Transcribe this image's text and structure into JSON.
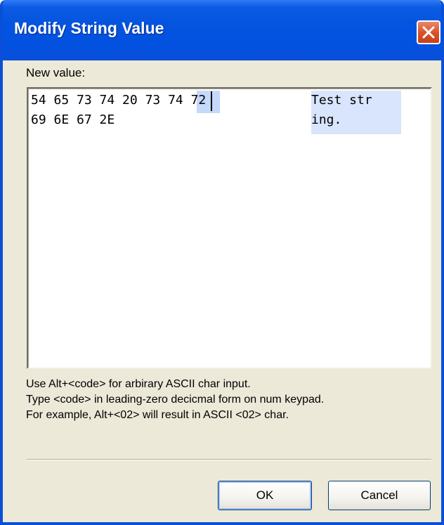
{
  "window": {
    "title": "Modify String Value",
    "close_icon": "close-icon"
  },
  "editor": {
    "label": "New value:",
    "hex_lines": [
      {
        "prefix": "54 65 73 74 20 ",
        "selected": "73",
        "suffix": " 74 72",
        "ascii": "Test str"
      },
      {
        "prefix": "69 6E 67 2E",
        "selected": "",
        "suffix": "",
        "ascii": "ing."
      }
    ]
  },
  "hint": {
    "line1": "Use Alt+<code> for arbirary ASCII char input.",
    "line2": "Type <code> in leading-zero decicmal form on num keypad.",
    "line3": "For example, Alt+<02> will result in ASCII <02> char."
  },
  "buttons": {
    "ok_label": "OK",
    "cancel_label": "Cancel"
  },
  "colors": {
    "titlebar": "#0454e0",
    "selection": "#c5d9fb",
    "close": "#d9542b"
  }
}
